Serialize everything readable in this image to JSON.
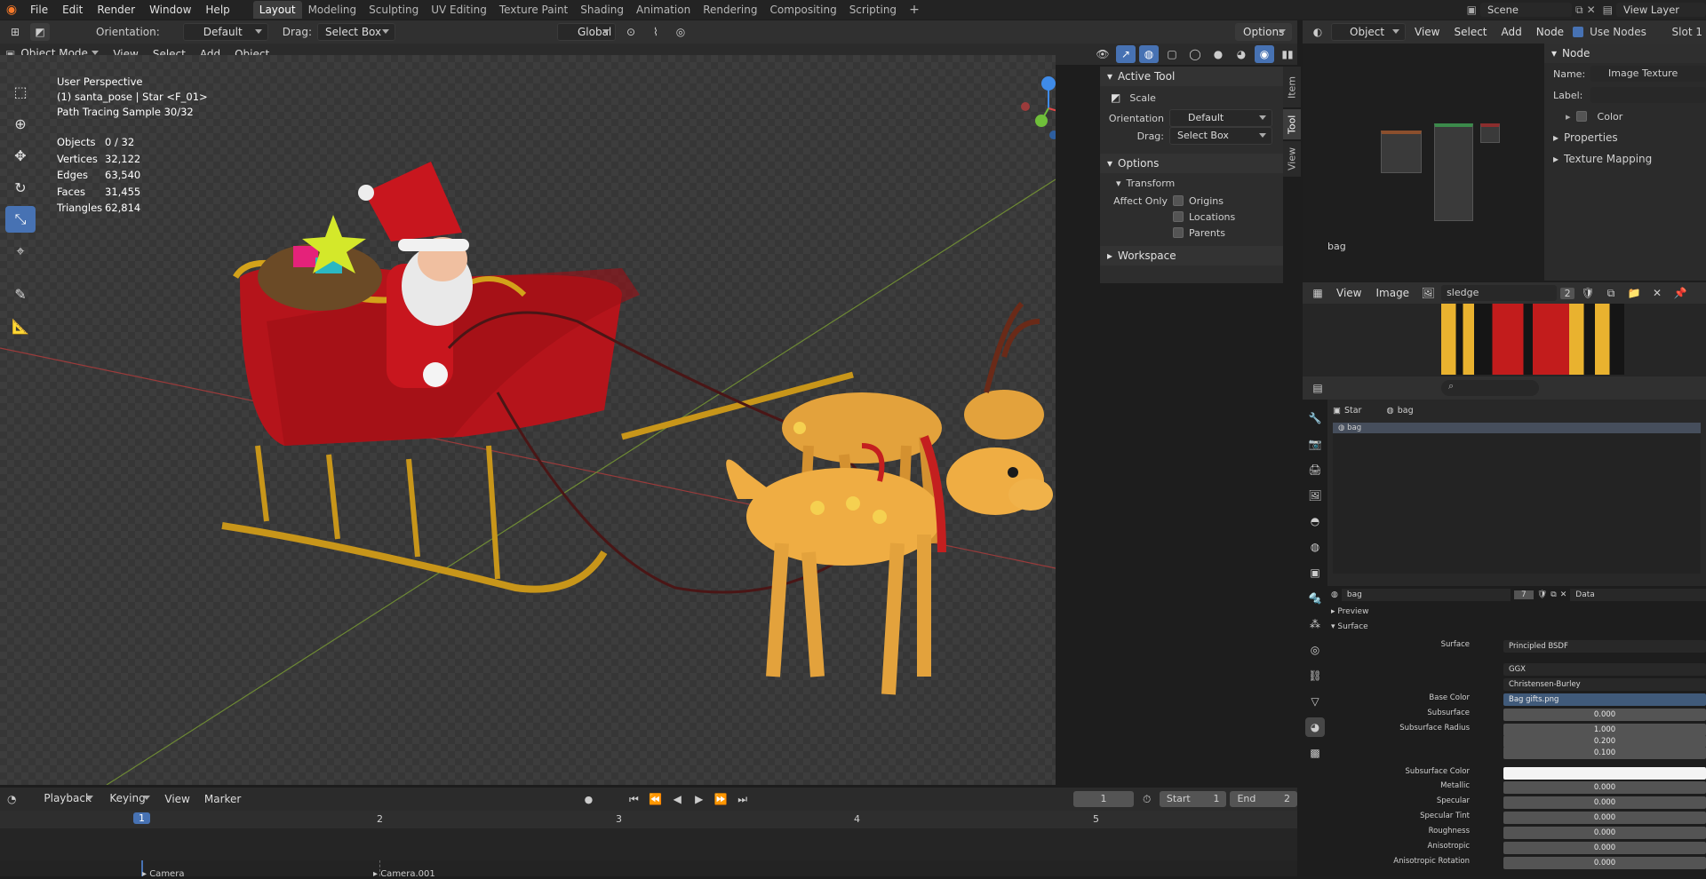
{
  "topbar": {
    "menus": [
      "File",
      "Edit",
      "Render",
      "Window",
      "Help"
    ],
    "workspaces": [
      "Layout",
      "Modeling",
      "Sculpting",
      "UV Editing",
      "Texture Paint",
      "Shading",
      "Animation",
      "Rendering",
      "Compositing",
      "Scripting"
    ],
    "active_workspace": "Layout",
    "scene": "Scene",
    "view_layer": "View Layer"
  },
  "viewport_header": {
    "orientation_label": "Orientation:",
    "orientation_value": "Default",
    "drag_label": "Drag:",
    "drag_value": "Select Box",
    "transform_orientation": "Global",
    "options": "Options",
    "mode": "Object Mode",
    "menus": [
      "View",
      "Select",
      "Add",
      "Object"
    ]
  },
  "overlay": {
    "line1": "User Perspective",
    "line2": "(1) santa_pose | Star <F_01>",
    "line3": "Path Tracing Sample 30/32",
    "stats": [
      {
        "label": "Objects",
        "value": "0 / 32"
      },
      {
        "label": "Vertices",
        "value": "32,122"
      },
      {
        "label": "Edges",
        "value": "63,540"
      },
      {
        "label": "Faces",
        "value": "31,455"
      },
      {
        "label": "Triangles",
        "value": "62,814"
      }
    ]
  },
  "npanel": {
    "active_tool_title": "Active Tool",
    "tool_name": "Scale",
    "orientation_label": "Orientation",
    "orientation_value": "Default",
    "drag_label": "Drag:",
    "drag_value": "Select Box",
    "options_title": "Options",
    "transform_title": "Transform",
    "affect_only": "Affect Only",
    "origins": "Origins",
    "locations": "Locations",
    "parents": "Parents",
    "workspace_title": "Workspace",
    "tabs": [
      "Item",
      "Tool",
      "View"
    ]
  },
  "timeline": {
    "menus": [
      "Playback",
      "Keying",
      "View",
      "Marker"
    ],
    "current_frame": "1",
    "start_label": "Start",
    "start_value": "1",
    "end_label": "End",
    "end_value": "2",
    "ruler": [
      "1",
      "2",
      "3",
      "4",
      "5"
    ],
    "markers": [
      "Camera",
      "Camera.001"
    ]
  },
  "node_editor": {
    "mode": "Object",
    "menus": [
      "View",
      "Select",
      "Add",
      "Node"
    ],
    "use_nodes": "Use Nodes",
    "slot": "Slot 1",
    "material_label": "bag"
  },
  "node_props": {
    "title": "Node",
    "name_label": "Name:",
    "name_value": "Image Texture",
    "label_label": "Label:",
    "color": "Color",
    "properties": "Properties",
    "texture_mapping": "Texture Mapping"
  },
  "image_editor": {
    "menus": [
      "View",
      "Image"
    ],
    "image_name": "sledge",
    "users": "2"
  },
  "outliner": {
    "breadcrumb_obj": "Star",
    "breadcrumb_mat": "bag",
    "slot_item": "bag"
  },
  "material": {
    "name": "bag",
    "users": "7",
    "link": "Data",
    "preview": "Preview",
    "surface_section": "Surface",
    "rows": [
      {
        "label": "Surface",
        "value": "Principled BSDF",
        "kind": "dark"
      },
      {
        "label": "",
        "value": "GGX",
        "kind": "dark"
      },
      {
        "label": "",
        "value": "Christensen-Burley",
        "kind": "dark"
      },
      {
        "label": "Base Color",
        "value": "Bag gifts.png",
        "kind": "blue"
      },
      {
        "label": "Subsurface",
        "value": "0.000",
        "kind": "num"
      },
      {
        "label": "Subsurface Radius",
        "value": "1.000",
        "kind": "num"
      },
      {
        "label": "",
        "value": "0.200",
        "kind": "num"
      },
      {
        "label": "",
        "value": "0.100",
        "kind": "num"
      },
      {
        "label": "Subsurface Color",
        "value": "",
        "kind": "white"
      },
      {
        "label": "Metallic",
        "value": "0.000",
        "kind": "num"
      },
      {
        "label": "Specular",
        "value": "0.000",
        "kind": "num"
      },
      {
        "label": "Specular Tint",
        "value": "0.000",
        "kind": "num"
      },
      {
        "label": "Roughness",
        "value": "0.000",
        "kind": "num"
      },
      {
        "label": "Anisotropic",
        "value": "0.000",
        "kind": "num"
      },
      {
        "label": "Anisotropic Rotation",
        "value": "0.000",
        "kind": "num"
      }
    ]
  }
}
